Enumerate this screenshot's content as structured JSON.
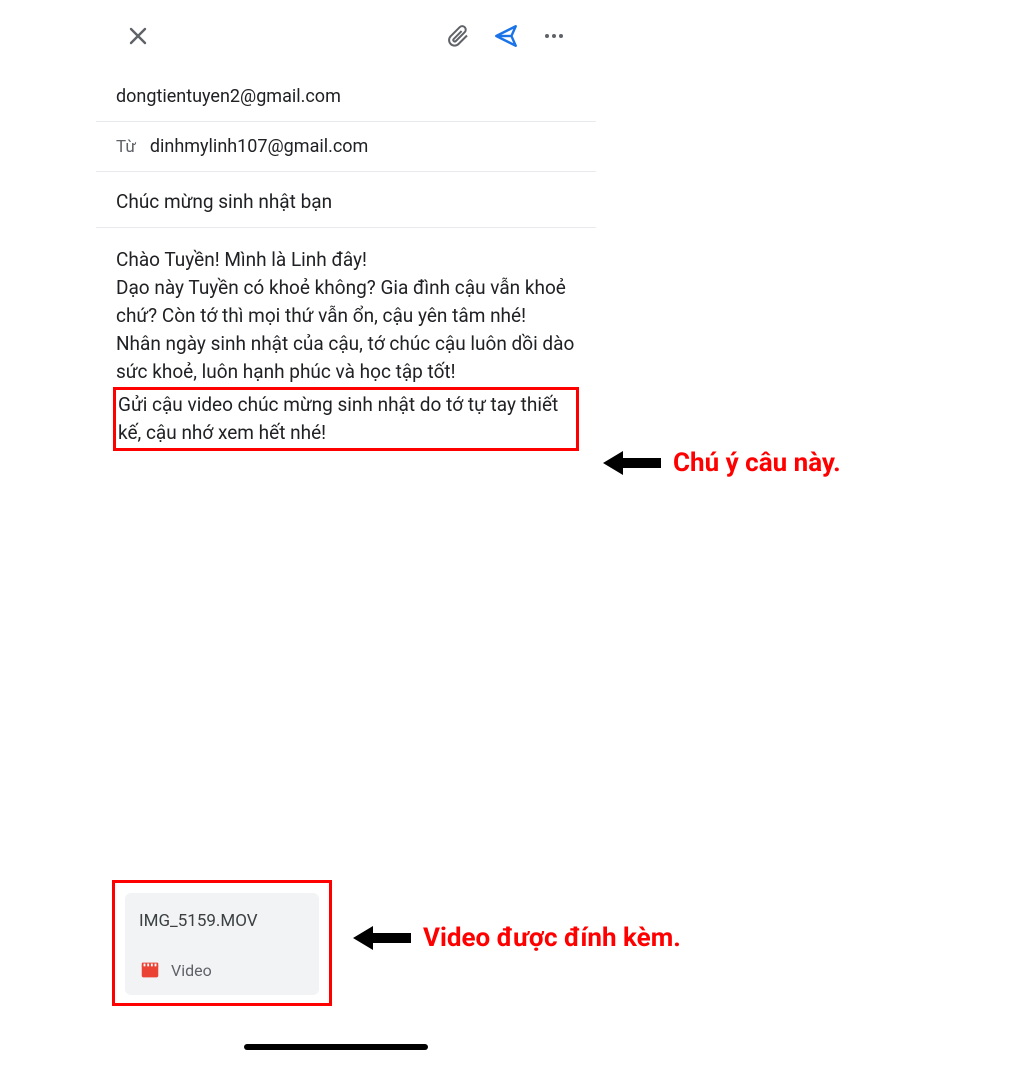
{
  "toolbar": {
    "close": "close-icon",
    "attach": "attach-icon",
    "send": "send-icon",
    "more": "more-icon"
  },
  "to": "dongtientuyen2@gmail.com",
  "from_label": "Từ",
  "from": "dinhmylinh107@gmail.com",
  "subject": "Chúc mừng sinh nhật bạn",
  "body": {
    "p1": "Chào Tuyền! Mình là Linh đây!",
    "p2": "Dạo này Tuyền có khoẻ không? Gia đình cậu vẫn khoẻ chứ? Còn tớ thì mọi thứ vẫn ổn, cậu yên tâm nhé!",
    "p3": "Nhân ngày sinh nhật của cậu, tớ chúc cậu luôn dồi dào sức khoẻ, luôn hạnh phúc và học tập tốt!",
    "p4": "Gửi cậu video chúc mừng sinh nhật do tớ tự tay thiết kế, cậu nhớ xem hết nhé!"
  },
  "attachment": {
    "filename": "IMG_5159.MOV",
    "type_label": "Video"
  },
  "annotations": {
    "a1": "Chú ý câu này.",
    "a2": "Video được đính kèm."
  }
}
